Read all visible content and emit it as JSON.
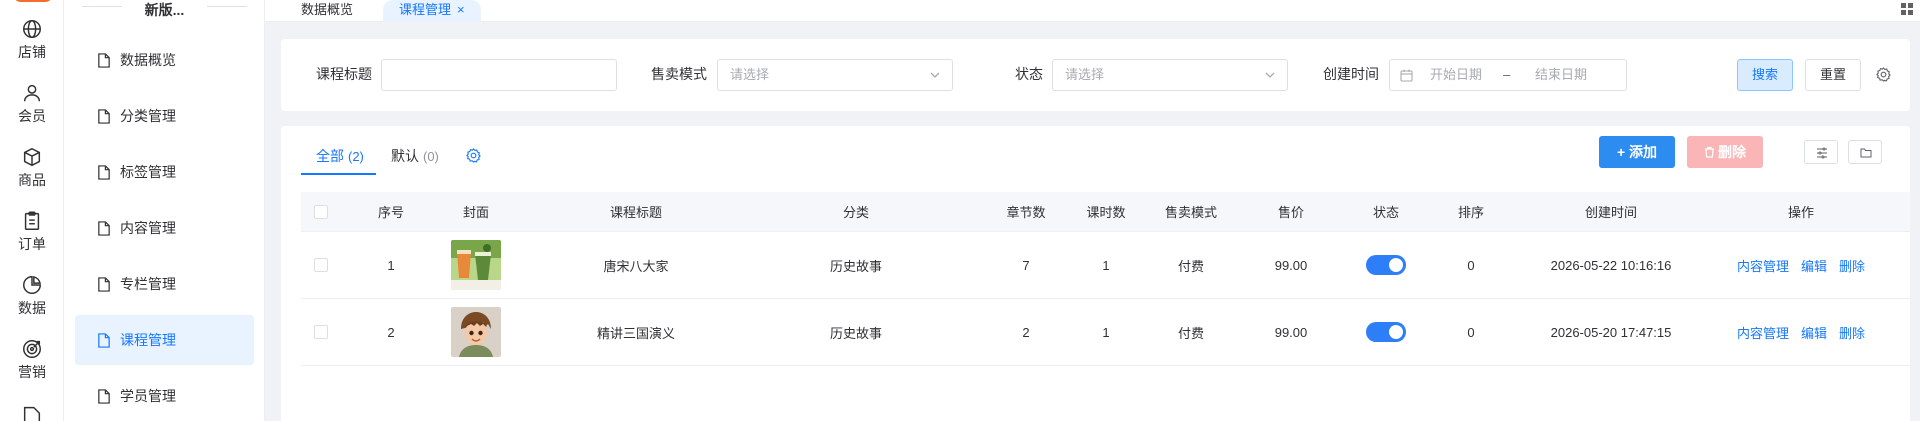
{
  "rail": {
    "items": [
      {
        "label": "店铺",
        "icon": "globe-icon"
      },
      {
        "label": "会员",
        "icon": "user-icon"
      },
      {
        "label": "商品",
        "icon": "box-icon"
      },
      {
        "label": "订单",
        "icon": "clipboard-icon"
      },
      {
        "label": "数据",
        "icon": "pie-chart-icon"
      },
      {
        "label": "营销",
        "icon": "target-icon"
      }
    ]
  },
  "submenu": {
    "title": "新版...",
    "items": [
      {
        "label": "数据概览"
      },
      {
        "label": "分类管理"
      },
      {
        "label": "标签管理"
      },
      {
        "label": "内容管理"
      },
      {
        "label": "专栏管理"
      },
      {
        "label": "课程管理",
        "active": true
      },
      {
        "label": "学员管理"
      }
    ]
  },
  "tabs": {
    "items": [
      {
        "label": "数据概览"
      },
      {
        "label": "课程管理",
        "active": true,
        "close": "×"
      }
    ]
  },
  "search": {
    "title_label": "课程标题",
    "title_value": "",
    "mode_label": "售卖模式",
    "mode_placeholder": "请选择",
    "status_label": "状态",
    "status_placeholder": "请选择",
    "date_label": "创建时间",
    "date_start_placeholder": "开始日期",
    "date_separator": "–",
    "date_end_placeholder": "结束日期",
    "search_button": "搜索",
    "reset_button": "重置"
  },
  "table_tabs": {
    "all_label": "全部",
    "all_count": "(2)",
    "default_label": "默认",
    "default_count": "(0)"
  },
  "toolbar": {
    "add_button": "+ 添加",
    "delete_button": "删除"
  },
  "table": {
    "columns": [
      "序号",
      "封面",
      "课程标题",
      "分类",
      "章节数",
      "课时数",
      "售卖模式",
      "售价",
      "状态",
      "排序",
      "创建时间",
      "操作"
    ],
    "rows": [
      {
        "index": "1",
        "title": "唐宋八大家",
        "category": "历史故事",
        "chapters": "7",
        "lessons": "1",
        "mode": "付费",
        "price": "99.00",
        "status_on": true,
        "sort": "0",
        "created": "2026-05-22 10:16:16",
        "cover": "drinks-photo"
      },
      {
        "index": "2",
        "title": "精讲三国演义",
        "category": "历史故事",
        "chapters": "2",
        "lessons": "1",
        "mode": "付费",
        "price": "99.00",
        "status_on": true,
        "sort": "0",
        "created": "2026-05-20 17:47:15",
        "cover": "cartoon-boy"
      }
    ],
    "actions": {
      "content": "内容管理",
      "edit": "编辑",
      "delete": "删除"
    }
  },
  "colors": {
    "primary": "#1677ff",
    "add_button": "#2d8cf0",
    "delete_disabled": "#fab6b6",
    "active_bg": "#e8f3ff"
  }
}
